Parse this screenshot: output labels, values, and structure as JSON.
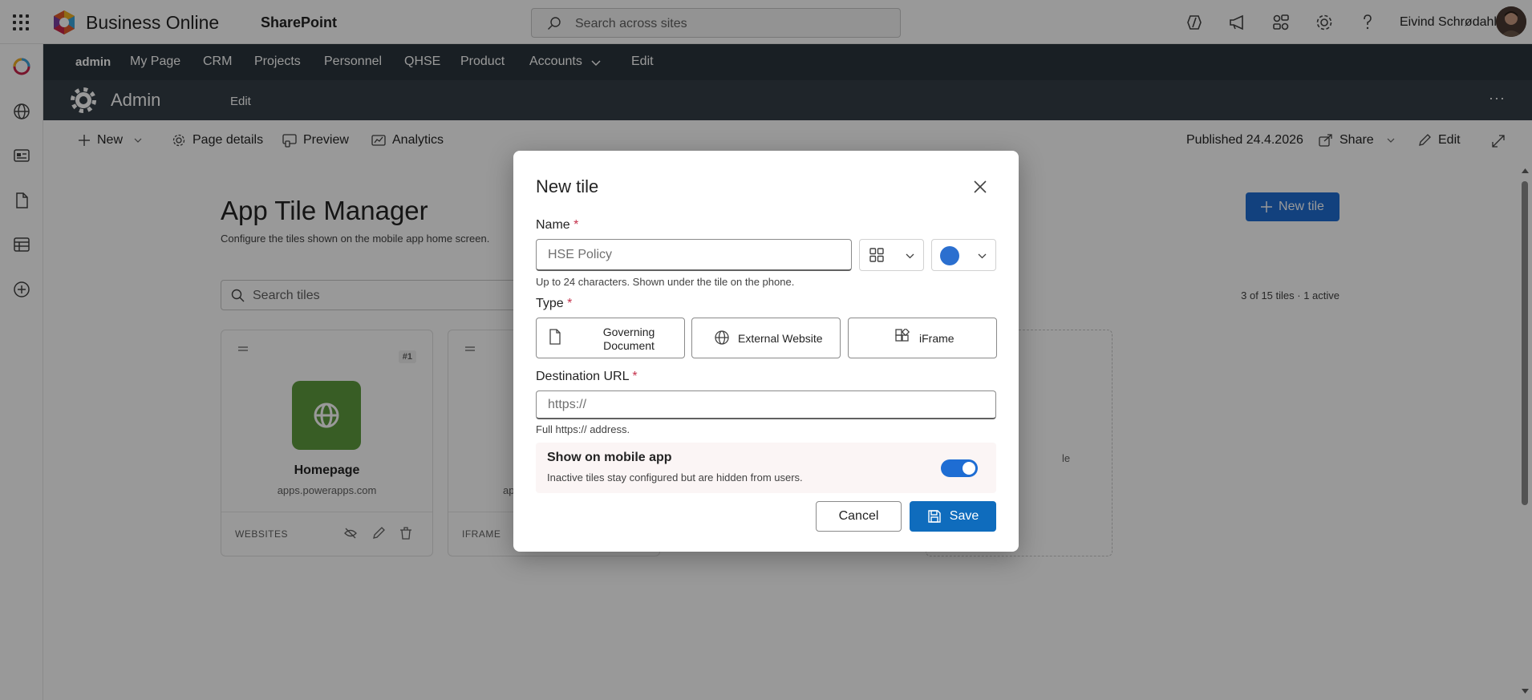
{
  "suitebar": {
    "brand": "Business Online",
    "app": "SharePoint",
    "search_placeholder": "Search across sites",
    "user_name": "Eivind Schrødahl"
  },
  "hubnav": {
    "items": [
      "admin",
      "My Page",
      "CRM",
      "Projects",
      "Personnel",
      "QHSE",
      "Product",
      "Accounts",
      "Edit"
    ]
  },
  "site": {
    "title": "Admin",
    "edit": "Edit",
    "more": "···"
  },
  "commandbar": {
    "new": "New",
    "page_details": "Page details",
    "preview": "Preview",
    "analytics": "Analytics",
    "published": "Published 24.4.2026",
    "share": "Share",
    "edit": "Edit"
  },
  "page": {
    "title": "App Tile Manager",
    "subtitle": "Configure the tiles shown on the mobile app home screen.",
    "new_tile": "New tile",
    "search_placeholder": "Search tiles",
    "counter": "3 of 15 tiles · 1 active"
  },
  "tiles": [
    {
      "num": "#1",
      "name": "Homepage",
      "url": "apps.powerapps.com",
      "type": "WEBSITES",
      "color": "#5e9b3e"
    },
    {
      "num": "",
      "name": "",
      "url": "ap",
      "type": "IFRAME",
      "color": ""
    }
  ],
  "partial_text": {
    "right_card_fragment": "le"
  },
  "dialog": {
    "title": "New tile",
    "name_label": "Name",
    "required": "*",
    "name_value": "HSE Policy",
    "name_hint": "Up to 24 characters. Shown under the tile on the phone.",
    "selected_color": "#2b6fcf",
    "type_label": "Type",
    "types": [
      "Governing Document",
      "External Website",
      "iFrame"
    ],
    "url_label": "Destination URL",
    "url_placeholder": "https://",
    "url_hint": "Full https:// address.",
    "mobile_title": "Show on mobile app",
    "mobile_desc": "Inactive tiles stay configured but are hidden from users.",
    "mobile_enabled": true,
    "cancel": "Cancel",
    "save": "Save"
  },
  "colors": {
    "accent": "#0f6cbd",
    "hub_bg": "#2a353c",
    "site_bg": "#343f47"
  }
}
